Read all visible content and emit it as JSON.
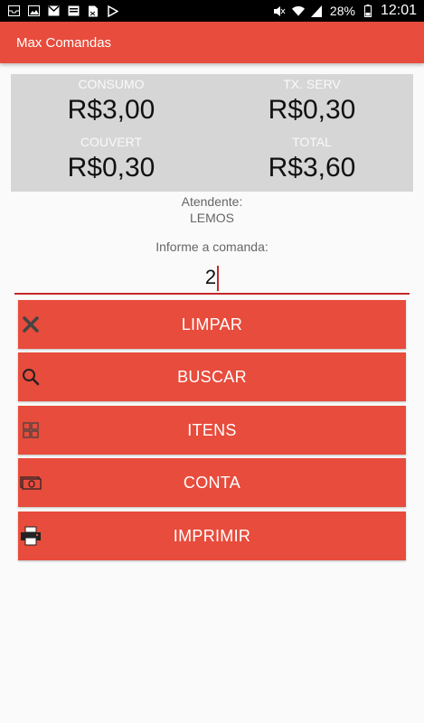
{
  "status_bar": {
    "battery": "28%",
    "time": "12:01",
    "left_icons": [
      "mail-icon",
      "image-icon",
      "gmail-icon",
      "email-icon",
      "document-icon",
      "play-store-icon"
    ],
    "right_icons": [
      "mute-icon",
      "wifi-icon",
      "signal-icon",
      "battery-icon"
    ]
  },
  "app": {
    "title": "Max Comandas",
    "accent": "#e74c3c"
  },
  "summary": {
    "consumo_label": "CONSUMO",
    "consumo_value": "R$3,00",
    "txserv_label": "TX. SERV",
    "txserv_value": "R$0,30",
    "couvert_label": "COUVERT",
    "couvert_value": "R$0,30",
    "total_label": "TOTAL",
    "total_value": "R$3,60"
  },
  "attendant": {
    "label": "Atendente:",
    "name": "LEMOS"
  },
  "comanda": {
    "prompt": "Informe a comanda:",
    "value": "2"
  },
  "buttons": [
    {
      "label": "LIMPAR",
      "icon": "close-icon"
    },
    {
      "label": "BUSCAR",
      "icon": "search-icon"
    },
    {
      "label": "ITENS",
      "icon": "grid-icon"
    },
    {
      "label": "CONTA",
      "icon": "money-icon"
    },
    {
      "label": "IMPRIMIR",
      "icon": "printer-icon"
    }
  ]
}
